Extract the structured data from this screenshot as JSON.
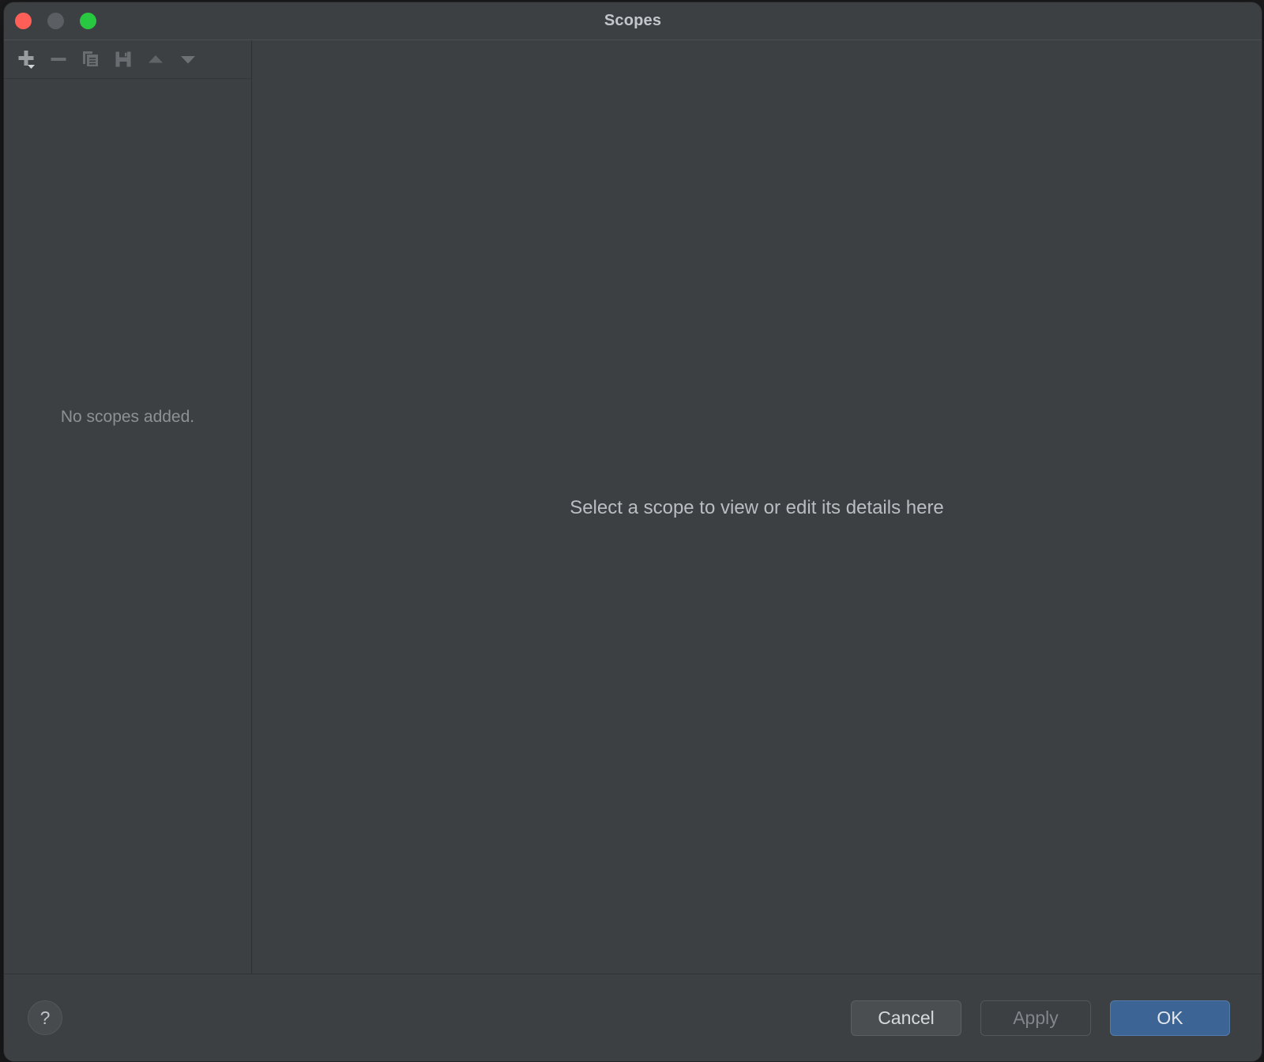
{
  "window": {
    "title": "Scopes",
    "traffic_lights": [
      {
        "name": "close",
        "color": "#ff5f57"
      },
      {
        "name": "minimize",
        "color": "#5b5e62"
      },
      {
        "name": "zoom",
        "color": "#28c840"
      }
    ]
  },
  "toolbar": {
    "buttons": [
      {
        "icon": "add-icon",
        "label": "Add",
        "has_dropdown": true,
        "enabled": true
      },
      {
        "icon": "remove-icon",
        "label": "Remove",
        "has_dropdown": false,
        "enabled": false
      },
      {
        "icon": "copy-icon",
        "label": "Duplicate",
        "has_dropdown": false,
        "enabled": false
      },
      {
        "icon": "save-icon",
        "label": "Save",
        "has_dropdown": false,
        "enabled": false
      },
      {
        "icon": "move-up-icon",
        "label": "Move Up",
        "has_dropdown": false,
        "enabled": false
      },
      {
        "icon": "move-down-icon",
        "label": "Move Down",
        "has_dropdown": false,
        "enabled": false
      }
    ]
  },
  "left_pane": {
    "empty_message": "No scopes added."
  },
  "right_pane": {
    "placeholder": "Select a scope to view or edit its details here"
  },
  "footer": {
    "help_label": "?",
    "cancel_label": "Cancel",
    "apply_label": "Apply",
    "ok_label": "OK",
    "apply_enabled": false
  },
  "colors": {
    "window_background": "#3c4043",
    "title_text": "#c3c7cb",
    "muted_text": "#8e9194",
    "primary_button": "#3c6494",
    "primary_button_border": "#557bab"
  }
}
